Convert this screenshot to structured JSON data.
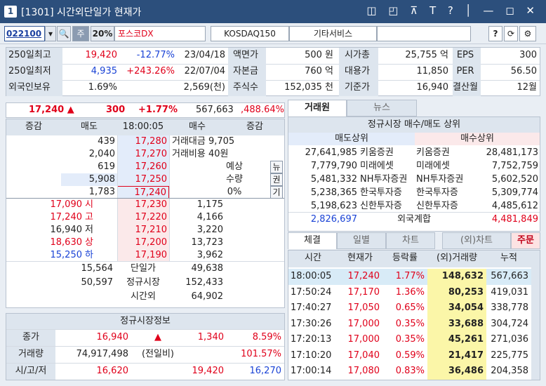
{
  "window": {
    "number": "1",
    "title": "[1301] 시간외단일가 현재가",
    "controls": "◫ ◰ ⊼ T ? │ — ◻ ✕"
  },
  "toolbar": {
    "code": "022100",
    "stock_name": "포스코DX",
    "ratio": "20%",
    "ju": "주",
    "market": "KOSDAQ150",
    "sector": "기타서비스",
    "help": "?"
  },
  "summary": {
    "rows": [
      {
        "l1": "250일최고",
        "v1": "19,420",
        "p1": "-12.77%",
        "d1": "23/04/18",
        "l2": "액면가",
        "v2": "500 원",
        "l3": "시가총",
        "v3": "25,755 억",
        "l4": "EPS",
        "v4": "300"
      },
      {
        "l1": "250일최저",
        "v1": "4,935",
        "p1": "+243.26%",
        "d1": "22/07/04",
        "l2": "자본금",
        "v2": "760 억",
        "l3": "대용가",
        "v3": "11,850",
        "l4": "PER",
        "v4": "56.50"
      },
      {
        "l1": "외국인보유",
        "v1": "1.69%",
        "p1": "",
        "d1": "2,569(천)",
        "l2": "주식수",
        "v2": "152,035 천",
        "l3": "기준가",
        "v3": "16,940",
        "l4": "결산월",
        "v4": "12월"
      }
    ]
  },
  "quote": {
    "price": "17,240 ▲",
    "change": "300",
    "pct": "+1.77%",
    "volume": "567,663",
    "vol_pct": ",488.64%"
  },
  "orderbook": {
    "headers": [
      "증감",
      "매도",
      "18:00:05",
      "매수",
      "증감"
    ],
    "asks": [
      {
        "qty": "439",
        "price": "17,280"
      },
      {
        "qty": "2,040",
        "price": "17,270"
      },
      {
        "qty": "619",
        "price": "17,260"
      },
      {
        "qty": "5,908",
        "price": "17,250"
      },
      {
        "qty": "1,783",
        "price": "17,240"
      }
    ],
    "bids": [
      {
        "price": "17,230",
        "qty": "1,175"
      },
      {
        "price": "17,220",
        "qty": "4,166"
      },
      {
        "price": "17,210",
        "qty": "3,220"
      },
      {
        "price": "17,200",
        "qty": "13,723"
      },
      {
        "price": "17,190",
        "qty": "3,962"
      }
    ],
    "info": [
      {
        "v": "17,090",
        "l": "시"
      },
      {
        "v": "17,240",
        "l": "고"
      },
      {
        "v": "16,940",
        "l": "저"
      },
      {
        "v": "18,630",
        "l": "상"
      },
      {
        "v": "15,250",
        "l": "하"
      }
    ],
    "trade_amount": "거래대금 9,705",
    "trade_cost": "거래비용 40원",
    "expect": "예상",
    "qty_label": "수량",
    "zero": "0%",
    "side_btns": [
      "뉴",
      "권",
      "기"
    ],
    "totals": [
      {
        "a": "15,564",
        "l": "단일가",
        "b": "49,638"
      },
      {
        "a": "50,597",
        "l": "정규시장",
        "b": "152,433"
      },
      {
        "a": "",
        "l": "시간외",
        "b": "64,902"
      }
    ]
  },
  "regular": {
    "title": "정규시장정보",
    "rows": [
      {
        "l": "종가",
        "a": "16,940",
        "b": "▲",
        "c": "1,340",
        "d": "8.59%"
      },
      {
        "l": "거래량",
        "a": "74,917,498",
        "b": "(전일비)",
        "c": "",
        "d": "101.57%"
      },
      {
        "l": "시/고/저",
        "a": "16,620",
        "b": "",
        "c": "19,420",
        "d": "16,270"
      }
    ]
  },
  "brokers": {
    "tabs": [
      "거래원",
      "뉴스"
    ],
    "title": "정규시장 매수/매도 상위",
    "sell_hdr": "매도상위",
    "buy_hdr": "매수상위",
    "rows": [
      {
        "sq": "27,641,985",
        "sn": "키움증권",
        "bn": "키움증권",
        "bq": "28,481,173"
      },
      {
        "sq": "7,779,790",
        "sn": "미래에셋",
        "bn": "미래에셋",
        "bq": "7,752,759"
      },
      {
        "sq": "5,481,332",
        "sn": "NH투자증권",
        "bn": "NH투자증권",
        "bq": "5,602,520"
      },
      {
        "sq": "5,238,365",
        "sn": "한국투자증",
        "bn": "한국투자증",
        "bq": "5,309,774"
      },
      {
        "sq": "5,198,623",
        "sn": "신한투자증",
        "bn": "신한투자증",
        "bq": "4,485,612"
      }
    ],
    "foreign": {
      "sq": "2,826,697",
      "l": "외국계합",
      "bq": "4,481,849"
    }
  },
  "ticks": {
    "tabs": [
      "체결",
      "일별",
      "차트",
      "(외)차트",
      "주문"
    ],
    "headers": [
      "시간",
      "현재가",
      "등락률",
      "(외)거래량",
      "누적"
    ],
    "rows": [
      {
        "t": "18:00:05",
        "p": "17,240",
        "r": "1.77%",
        "v": "148,632",
        "c": "567,663"
      },
      {
        "t": "17:50:24",
        "p": "17,170",
        "r": "1.36%",
        "v": "80,253",
        "c": "419,031"
      },
      {
        "t": "17:40:27",
        "p": "17,050",
        "r": "0.65%",
        "v": "34,054",
        "c": "338,778"
      },
      {
        "t": "17:30:26",
        "p": "17,000",
        "r": "0.35%",
        "v": "33,688",
        "c": "304,724"
      },
      {
        "t": "17:20:13",
        "p": "17,000",
        "r": "0.35%",
        "v": "45,261",
        "c": "271,036"
      },
      {
        "t": "17:10:20",
        "p": "17,040",
        "r": "0.59%",
        "v": "21,417",
        "c": "225,775"
      },
      {
        "t": "17:00:14",
        "p": "17,080",
        "r": "0.83%",
        "v": "36,486",
        "c": "204,358"
      }
    ]
  },
  "colors": {
    "title_bg": "#2c4f7c",
    "up": "#e0001a",
    "down": "#1a43d6",
    "volume_bg": "#fbf6a8",
    "ask_bg": "#e3ecfa",
    "bid_bg": "#fbe9ea"
  }
}
